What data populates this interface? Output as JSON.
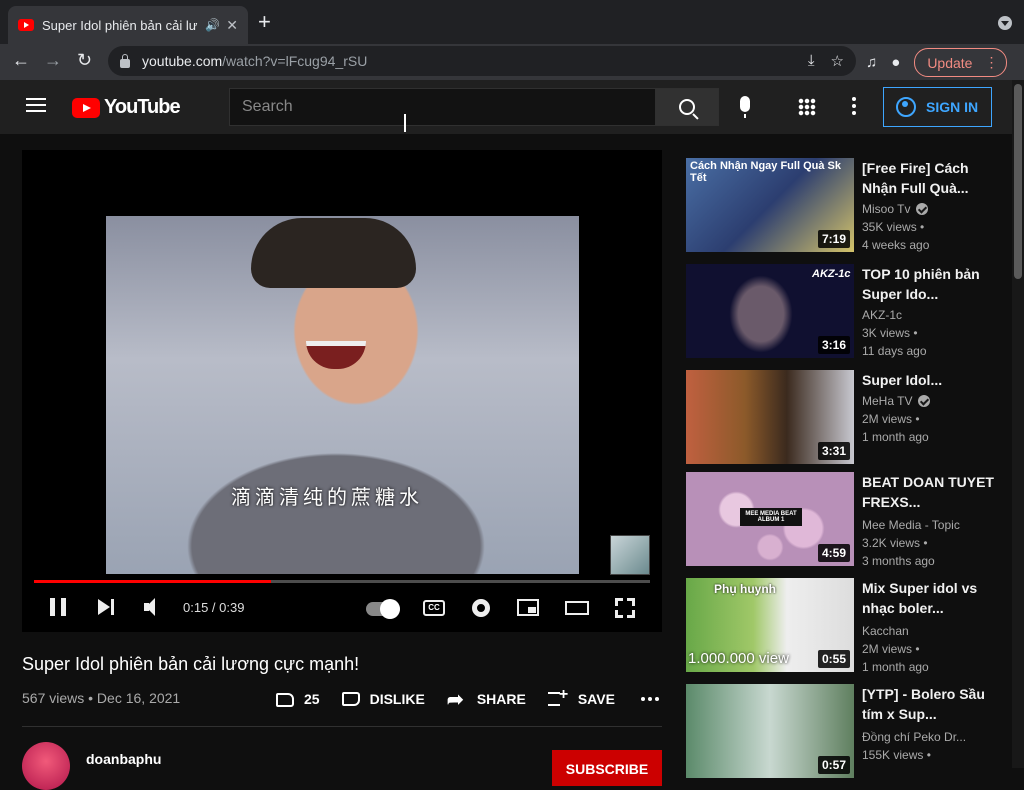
{
  "browser": {
    "tab_title": "Super Idol phiên bản cải lư",
    "tab_audio_icon": "speaker-icon",
    "new_tab_label": "+",
    "url_host": "youtube.com",
    "url_path": "/watch?v=lFcug94_rSU",
    "update_label": "Update"
  },
  "masthead": {
    "logo_text": "YouTube",
    "search_placeholder": "Search",
    "signin_label": "SIGN IN"
  },
  "player": {
    "time": "0:15 / 0:39",
    "progress": 0.385,
    "subtitle": "滴滴清纯的蔗糖水"
  },
  "video": {
    "title": "Super Idol phiên bản cải lương cực mạnh!",
    "meta": "567 views • Dec 16, 2021",
    "like_count": "25",
    "dislike_label": "DISLIKE",
    "share_label": "SHARE",
    "save_label": "SAVE"
  },
  "channel": {
    "name": "doanbaphu",
    "subscribe_label": "SUBSCRIBE"
  },
  "recommendations": [
    {
      "title": "[Free Fire] Cách Nhận Full Quà...",
      "channel": "Misoo Tv",
      "verified": true,
      "views": "35K views •",
      "age": "4 weeks ago",
      "duration": "7:19",
      "thumb_caption": "Cách Nhận Ngay Full Quà Sk Tết"
    },
    {
      "title": "TOP 10 phiên bản Super Ido...",
      "channel": "AKZ-1c",
      "verified": false,
      "views": "3K views •",
      "age": "11 days ago",
      "duration": "3:16",
      "thumb_caption": "AKZ-1c"
    },
    {
      "title": "Super Idol...",
      "channel": "MeHa TV",
      "verified": true,
      "views": "2M views •",
      "age": "1 month ago",
      "duration": "3:31",
      "thumb_caption": ""
    },
    {
      "title": "BEAT DOAN TUYET FREXS...",
      "channel": "Mee Media - Topic",
      "verified": false,
      "views": "3.2K views •",
      "age": "3 months ago",
      "duration": "4:59",
      "thumb_caption": "MEE MEDIA BEAT ALBUM 1"
    },
    {
      "title": "Mix Super idol vs nhạc boler...",
      "channel": "Kacchan",
      "verified": false,
      "views": "2M views •",
      "age": "1 month ago",
      "duration": "0:55",
      "thumb_caption": "Phụ huynh",
      "thumb_caption2": "1.000.000 view"
    },
    {
      "title": "[YTP] - Bolero Sầu tím x Sup...",
      "channel": "Đồng chí Peko Dr...",
      "verified": false,
      "views": "155K views •",
      "age": "",
      "duration": "0:57",
      "thumb_caption": ""
    }
  ]
}
